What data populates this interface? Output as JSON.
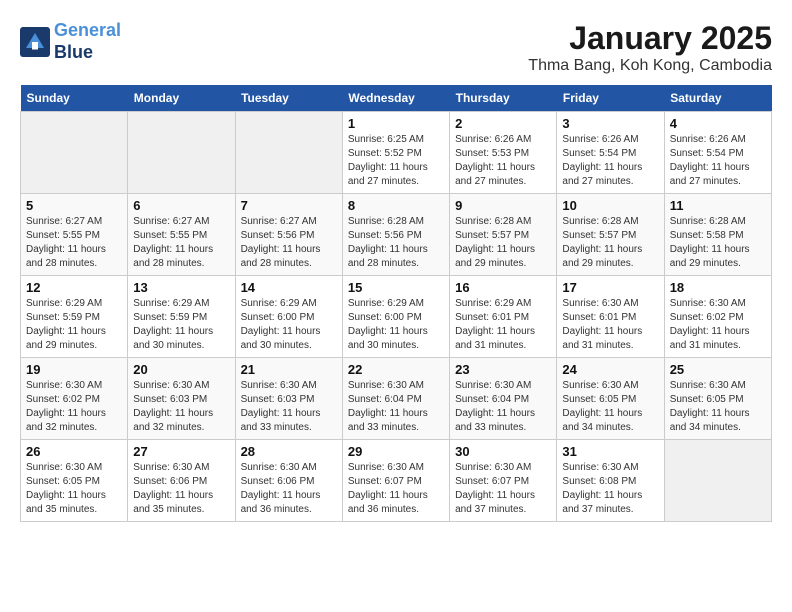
{
  "header": {
    "logo_line1": "General",
    "logo_line2": "Blue",
    "title": "January 2025",
    "subtitle": "Thma Bang, Koh Kong, Cambodia"
  },
  "weekdays": [
    "Sunday",
    "Monday",
    "Tuesday",
    "Wednesday",
    "Thursday",
    "Friday",
    "Saturday"
  ],
  "weeks": [
    [
      {
        "num": "",
        "sunrise": "",
        "sunset": "",
        "daylight": "",
        "empty": true
      },
      {
        "num": "",
        "sunrise": "",
        "sunset": "",
        "daylight": "",
        "empty": true
      },
      {
        "num": "",
        "sunrise": "",
        "sunset": "",
        "daylight": "",
        "empty": true
      },
      {
        "num": "1",
        "sunrise": "Sunrise: 6:25 AM",
        "sunset": "Sunset: 5:52 PM",
        "daylight": "Daylight: 11 hours and 27 minutes.",
        "empty": false
      },
      {
        "num": "2",
        "sunrise": "Sunrise: 6:26 AM",
        "sunset": "Sunset: 5:53 PM",
        "daylight": "Daylight: 11 hours and 27 minutes.",
        "empty": false
      },
      {
        "num": "3",
        "sunrise": "Sunrise: 6:26 AM",
        "sunset": "Sunset: 5:54 PM",
        "daylight": "Daylight: 11 hours and 27 minutes.",
        "empty": false
      },
      {
        "num": "4",
        "sunrise": "Sunrise: 6:26 AM",
        "sunset": "Sunset: 5:54 PM",
        "daylight": "Daylight: 11 hours and 27 minutes.",
        "empty": false
      }
    ],
    [
      {
        "num": "5",
        "sunrise": "Sunrise: 6:27 AM",
        "sunset": "Sunset: 5:55 PM",
        "daylight": "Daylight: 11 hours and 28 minutes.",
        "empty": false
      },
      {
        "num": "6",
        "sunrise": "Sunrise: 6:27 AM",
        "sunset": "Sunset: 5:55 PM",
        "daylight": "Daylight: 11 hours and 28 minutes.",
        "empty": false
      },
      {
        "num": "7",
        "sunrise": "Sunrise: 6:27 AM",
        "sunset": "Sunset: 5:56 PM",
        "daylight": "Daylight: 11 hours and 28 minutes.",
        "empty": false
      },
      {
        "num": "8",
        "sunrise": "Sunrise: 6:28 AM",
        "sunset": "Sunset: 5:56 PM",
        "daylight": "Daylight: 11 hours and 28 minutes.",
        "empty": false
      },
      {
        "num": "9",
        "sunrise": "Sunrise: 6:28 AM",
        "sunset": "Sunset: 5:57 PM",
        "daylight": "Daylight: 11 hours and 29 minutes.",
        "empty": false
      },
      {
        "num": "10",
        "sunrise": "Sunrise: 6:28 AM",
        "sunset": "Sunset: 5:57 PM",
        "daylight": "Daylight: 11 hours and 29 minutes.",
        "empty": false
      },
      {
        "num": "11",
        "sunrise": "Sunrise: 6:28 AM",
        "sunset": "Sunset: 5:58 PM",
        "daylight": "Daylight: 11 hours and 29 minutes.",
        "empty": false
      }
    ],
    [
      {
        "num": "12",
        "sunrise": "Sunrise: 6:29 AM",
        "sunset": "Sunset: 5:59 PM",
        "daylight": "Daylight: 11 hours and 29 minutes.",
        "empty": false
      },
      {
        "num": "13",
        "sunrise": "Sunrise: 6:29 AM",
        "sunset": "Sunset: 5:59 PM",
        "daylight": "Daylight: 11 hours and 30 minutes.",
        "empty": false
      },
      {
        "num": "14",
        "sunrise": "Sunrise: 6:29 AM",
        "sunset": "Sunset: 6:00 PM",
        "daylight": "Daylight: 11 hours and 30 minutes.",
        "empty": false
      },
      {
        "num": "15",
        "sunrise": "Sunrise: 6:29 AM",
        "sunset": "Sunset: 6:00 PM",
        "daylight": "Daylight: 11 hours and 30 minutes.",
        "empty": false
      },
      {
        "num": "16",
        "sunrise": "Sunrise: 6:29 AM",
        "sunset": "Sunset: 6:01 PM",
        "daylight": "Daylight: 11 hours and 31 minutes.",
        "empty": false
      },
      {
        "num": "17",
        "sunrise": "Sunrise: 6:30 AM",
        "sunset": "Sunset: 6:01 PM",
        "daylight": "Daylight: 11 hours and 31 minutes.",
        "empty": false
      },
      {
        "num": "18",
        "sunrise": "Sunrise: 6:30 AM",
        "sunset": "Sunset: 6:02 PM",
        "daylight": "Daylight: 11 hours and 31 minutes.",
        "empty": false
      }
    ],
    [
      {
        "num": "19",
        "sunrise": "Sunrise: 6:30 AM",
        "sunset": "Sunset: 6:02 PM",
        "daylight": "Daylight: 11 hours and 32 minutes.",
        "empty": false
      },
      {
        "num": "20",
        "sunrise": "Sunrise: 6:30 AM",
        "sunset": "Sunset: 6:03 PM",
        "daylight": "Daylight: 11 hours and 32 minutes.",
        "empty": false
      },
      {
        "num": "21",
        "sunrise": "Sunrise: 6:30 AM",
        "sunset": "Sunset: 6:03 PM",
        "daylight": "Daylight: 11 hours and 33 minutes.",
        "empty": false
      },
      {
        "num": "22",
        "sunrise": "Sunrise: 6:30 AM",
        "sunset": "Sunset: 6:04 PM",
        "daylight": "Daylight: 11 hours and 33 minutes.",
        "empty": false
      },
      {
        "num": "23",
        "sunrise": "Sunrise: 6:30 AM",
        "sunset": "Sunset: 6:04 PM",
        "daylight": "Daylight: 11 hours and 33 minutes.",
        "empty": false
      },
      {
        "num": "24",
        "sunrise": "Sunrise: 6:30 AM",
        "sunset": "Sunset: 6:05 PM",
        "daylight": "Daylight: 11 hours and 34 minutes.",
        "empty": false
      },
      {
        "num": "25",
        "sunrise": "Sunrise: 6:30 AM",
        "sunset": "Sunset: 6:05 PM",
        "daylight": "Daylight: 11 hours and 34 minutes.",
        "empty": false
      }
    ],
    [
      {
        "num": "26",
        "sunrise": "Sunrise: 6:30 AM",
        "sunset": "Sunset: 6:05 PM",
        "daylight": "Daylight: 11 hours and 35 minutes.",
        "empty": false
      },
      {
        "num": "27",
        "sunrise": "Sunrise: 6:30 AM",
        "sunset": "Sunset: 6:06 PM",
        "daylight": "Daylight: 11 hours and 35 minutes.",
        "empty": false
      },
      {
        "num": "28",
        "sunrise": "Sunrise: 6:30 AM",
        "sunset": "Sunset: 6:06 PM",
        "daylight": "Daylight: 11 hours and 36 minutes.",
        "empty": false
      },
      {
        "num": "29",
        "sunrise": "Sunrise: 6:30 AM",
        "sunset": "Sunset: 6:07 PM",
        "daylight": "Daylight: 11 hours and 36 minutes.",
        "empty": false
      },
      {
        "num": "30",
        "sunrise": "Sunrise: 6:30 AM",
        "sunset": "Sunset: 6:07 PM",
        "daylight": "Daylight: 11 hours and 37 minutes.",
        "empty": false
      },
      {
        "num": "31",
        "sunrise": "Sunrise: 6:30 AM",
        "sunset": "Sunset: 6:08 PM",
        "daylight": "Daylight: 11 hours and 37 minutes.",
        "empty": false
      },
      {
        "num": "",
        "sunrise": "",
        "sunset": "",
        "daylight": "",
        "empty": true
      }
    ]
  ]
}
